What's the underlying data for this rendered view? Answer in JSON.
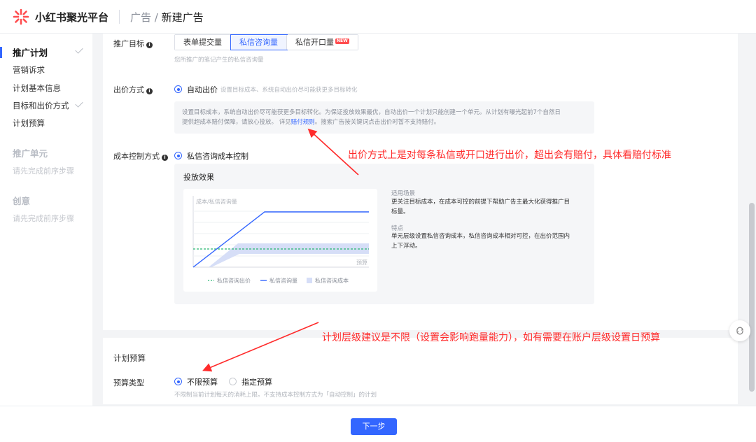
{
  "header": {
    "logo_text": "小红书聚光平台",
    "breadcrumb_parent": "广告",
    "breadcrumb_sep": " / ",
    "breadcrumb_current": "新建广告"
  },
  "sidebar": {
    "sections": [
      {
        "title": "推广计划",
        "items": [
          "营销诉求",
          "计划基本信息",
          "目标和出价方式",
          "计划预算"
        ]
      },
      {
        "title": "推广单元",
        "sub": "请先完成前序步骤"
      },
      {
        "title": "创意",
        "sub": "请先完成前序步骤"
      }
    ]
  },
  "form": {
    "goal_label": "推广目标",
    "goal_options": [
      "表单提交量",
      "私信咨询量",
      "私信开口量"
    ],
    "goal_selected": "私信咨询量",
    "goal_new_badge": "NEW",
    "goal_hint": "您所推广的笔记产生的私信咨询量",
    "bid_label": "出价方式",
    "bid_option": "自动出价",
    "bid_option_hint": "设置目标成本、系统自动出价尽可能获更多目标转化",
    "bid_desc_line1": "设置目标成本，系统自动出价尽可能获更多目标转化。为保证投放效果最优，自动出价一个计划只能创建一个单元。从计划有曝光起前7个自然日",
    "bid_desc_line2_a": "提供超成本赔付保障，请放心投放。 详见",
    "bid_desc_link": "赔付规则",
    "bid_desc_line2_b": "。搜索广告按关键词点击出价时暂不支持赔付。",
    "cost_label": "成本控制方式",
    "cost_option": "私信咨询成本控制",
    "effect_title": "投放效果",
    "scene_title": "适用场景",
    "scene_text_1": "更关注目标成本，在成本可控的前提下帮助广告主最大化获得推广目",
    "scene_text_2": "标量。",
    "feature_title": "特点",
    "feature_text_1": "单元层级设置私信咨询成本，私信咨询成本相对可控，在出价范围内",
    "feature_text_2": "上下浮动。",
    "budget_section_title": "计划预算",
    "budget_type_label": "预算类型",
    "budget_options": [
      "不限预算",
      "指定预算"
    ],
    "budget_hint": "不限制当前计划每天的消耗上限。不支持成本控制方式为「自动控制」的计划"
  },
  "chart_data": {
    "type": "line",
    "ylabel": "成本/私信咨询量",
    "xlabel": "预算",
    "legend": [
      "私信咨询出价",
      "私信咨询量",
      "私信咨询成本"
    ],
    "colors": {
      "bid": "#2bb673",
      "volume": "#3366ff",
      "cost_band": "#d6def7"
    }
  },
  "annotations": {
    "bid_note": "出价方式上是对每条私信或开口进行出价，超出会有赔付，具体看赔付标准",
    "budget_note": "计划层级建议是不限（设置会影响跑量能力），如有需要在账户层级设置日预算"
  },
  "footer": {
    "next_label": "下一步"
  }
}
